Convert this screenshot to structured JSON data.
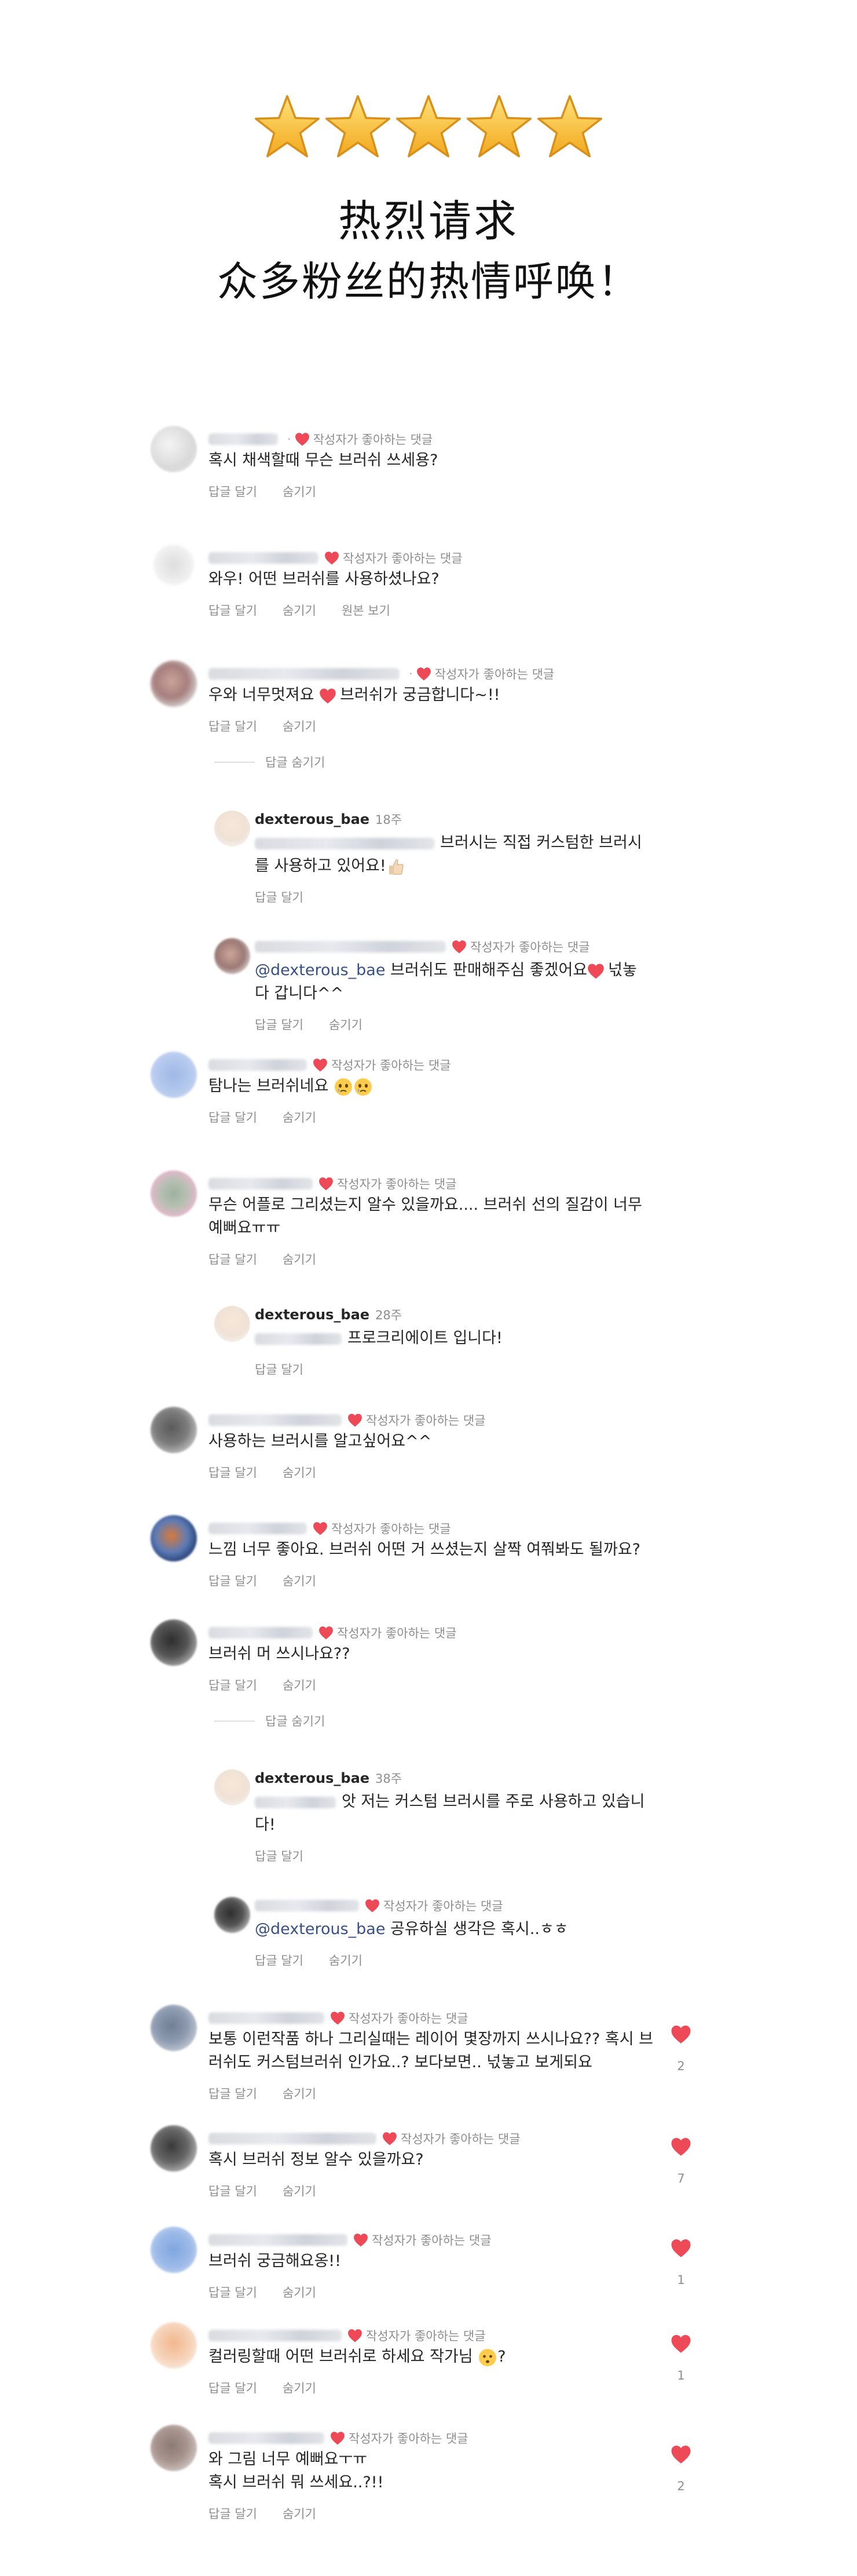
{
  "header": {
    "stars": [
      "star-icon",
      "star-icon",
      "star-icon",
      "star-icon",
      "star-icon"
    ],
    "title": "热烈请求",
    "subtitle": "众多粉丝的热情呼唤！"
  },
  "labels": {
    "liked_by_author": "작성자가 좋아하는 댓글",
    "reply": "답글 달기",
    "hide": "숨기기",
    "view_original": "원본 보기",
    "hide_replies": "답글 숨기기"
  },
  "colors": {
    "heart": "#ed4956",
    "star": "#f4b400",
    "mention": "#385185",
    "muted": "#8e8e8e"
  },
  "comments": [
    {
      "text": "혹시 채색할때 무슨 브러쉬 쓰세용?"
    },
    {
      "text": "와우! 어떤 브러쉬를 사용하셨나요?"
    },
    {
      "text_a": "우와 너무멋져요",
      "text_b": "브러쉬가 궁금합니다~!!"
    },
    {
      "author": "dexterous_bae",
      "time": "18주",
      "text_a": "브러시는 직접 커스텀한 브러시",
      "text_b": "를 사용하고 있어요!"
    },
    {
      "mention": "@dexterous_bae",
      "text_a": "브러쉬도 판매해주심 좋겠어요",
      "text_b": "넋놓",
      "text_c": "다 갑니다^^"
    },
    {
      "text": "탐나는 브러쉬네요"
    },
    {
      "text_a": "무슨 어플로 그리셨는지 알수 있을까요.... 브러쉬 선의 질감이 너무",
      "text_b": "예뻐요ㅠㅠ"
    },
    {
      "author": "dexterous_bae",
      "time": "28주",
      "text": "프로크리에이트 입니다!"
    },
    {
      "text": "사용하는 브러시를 알고싶어요^^"
    },
    {
      "text": "느낌 너무 좋아요. 브러쉬 어떤 거 쓰셨는지 살짝 여쭤봐도 될까요?"
    },
    {
      "text": "브러쉬 머 쓰시나요??"
    },
    {
      "author": "dexterous_bae",
      "time": "38주",
      "text_a": "앗 저는 커스텀 브러시를 주로 사용하고 있습니",
      "text_b": "다!"
    },
    {
      "mention": "@dexterous_bae",
      "text": "공유하실 생각은 혹시..ㅎㅎ"
    },
    {
      "text_a": "보통 이런작품 하나 그리실때는 레이어 몇장까지 쓰시나요?? 혹시 브",
      "text_b": "러쉬도 커스텀브러쉬 인가요..? 보다보면.. 넋놓고 보게되요",
      "likes": "2"
    },
    {
      "text": "혹시 브러쉬 정보 알수 있을까요?",
      "likes": "7"
    },
    {
      "text": "브러쉬 궁금해요옹!!",
      "likes": "1"
    },
    {
      "text_a": "컬러링할때 어떤 브러쉬로 하세요 작가님",
      "text_b": "?",
      "likes": "1"
    },
    {
      "text_a": "와 그림 너무 예뻐요ㅜㅠ",
      "text_b": "혹시 브러쉬 뭐 쓰세요..?!!",
      "likes": "2"
    }
  ]
}
